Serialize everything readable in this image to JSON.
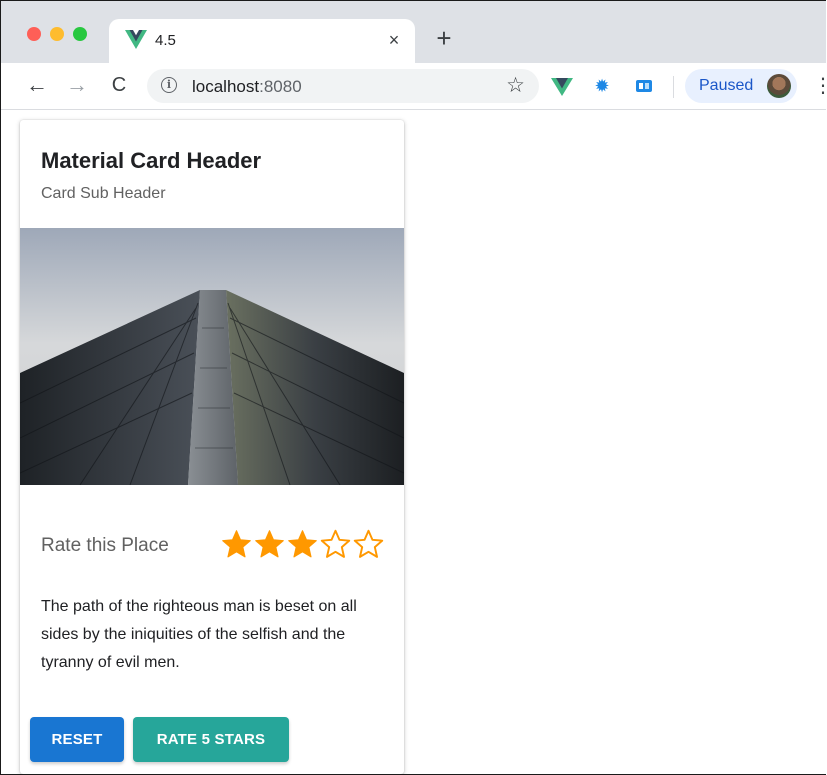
{
  "browser": {
    "tab": {
      "title": "4.5",
      "favicon": "vue-logo-icon",
      "close_label": "×"
    },
    "new_tab_label": "+",
    "address": {
      "host": "localhost",
      "port": ":8080"
    },
    "profile": {
      "label": "Paused",
      "avatar": "user-avatar"
    },
    "colors": {
      "tabstrip": "#dee1e6",
      "paused_bg": "#e8f0fe",
      "paused_text": "#1a56c8"
    }
  },
  "card": {
    "title": "Material Card Header",
    "subtitle": "Card Sub Header",
    "image": "skyscraper-photo",
    "rating": {
      "label": "Rate this Place",
      "value": 3,
      "max": 5,
      "color": "#ff9800"
    },
    "text": "The path of the righteous man is beset on all sides by the iniquities of the selfish and the tyranny of evil men.",
    "buttons": {
      "reset": {
        "label": "RESET",
        "color": "#1976d2"
      },
      "rate5": {
        "label": "RATE 5 STARS",
        "color": "#26a69a"
      }
    }
  }
}
